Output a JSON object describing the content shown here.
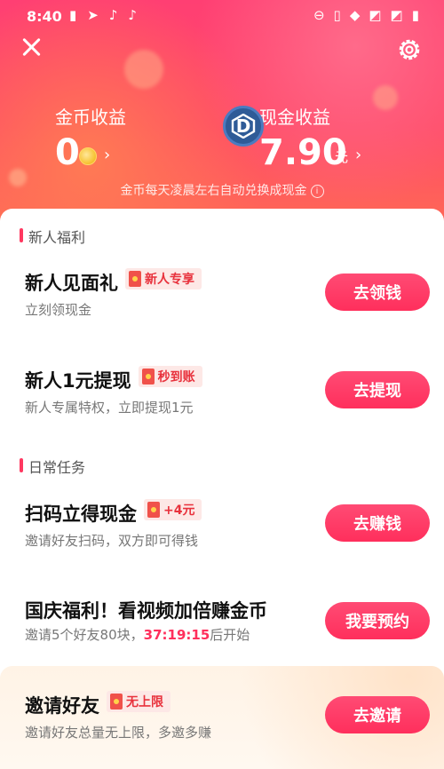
{
  "status_bar": {
    "time": "8:40",
    "left_icons": [
      "battery-plus-icon",
      "navigation-icon",
      "tiktok-icon",
      "tiktok-icon"
    ],
    "right_icons": [
      "dnd-icon",
      "vibrate-icon",
      "wifi-icon",
      "no-signal-icon",
      "no-signal-icon",
      "battery-icon"
    ]
  },
  "header": {
    "coin_label": "金币收益",
    "coin_value": "0",
    "cash_label": "现金收益",
    "cash_value": "7.90",
    "cash_unit": "元",
    "badge_letter": "D",
    "note": "金币每天凌晨左右自动兑换成现金",
    "info_symbol": "i"
  },
  "sections": {
    "new_user": "新人福利",
    "daily": "日常任务"
  },
  "tasks": [
    {
      "title": "新人见面礼",
      "tag": "新人专享",
      "subtitle": "立刻领现金",
      "button": "去领钱"
    },
    {
      "title": "新人1元提现",
      "tag": "秒到账",
      "subtitle": "新人专属特权，立即提现1元",
      "button": "去提现"
    },
    {
      "title": "扫码立得现金",
      "tag": "+4元",
      "subtitle": "邀请好友扫码，双方即可得钱",
      "button": "去赚钱"
    },
    {
      "title": "国庆福利！看视频加倍赚金币",
      "subtitle_prefix": "邀请5个好友80块，",
      "countdown": "37:19:15",
      "subtitle_suffix": "后开始",
      "button": "我要预约"
    },
    {
      "title": "邀请好友",
      "tag": "无上限",
      "subtitle": "邀请好友总量无上限，多邀多赚",
      "button": "去邀请"
    }
  ],
  "colors": {
    "accent": "#ff2f5c",
    "header_top": "#ff3f73",
    "header_bottom": "#ff6a55",
    "tag_bg": "#fde8e6",
    "tag_text": "#e8313c",
    "badge": "#2f5b97"
  }
}
